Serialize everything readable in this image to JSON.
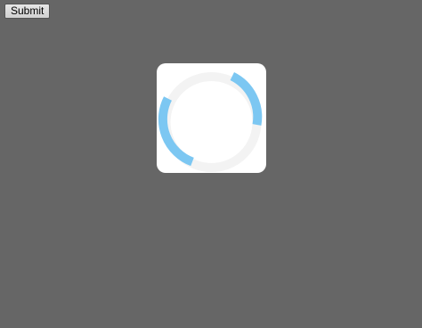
{
  "form": {
    "submit_label": "Submit"
  },
  "loader": {
    "spinner_icon": "loading-spinner-icon",
    "track_color": "#f3f3f3",
    "arc_color": "#7cc7f2",
    "card_color": "#ffffff",
    "overlay_color": "#666666"
  }
}
